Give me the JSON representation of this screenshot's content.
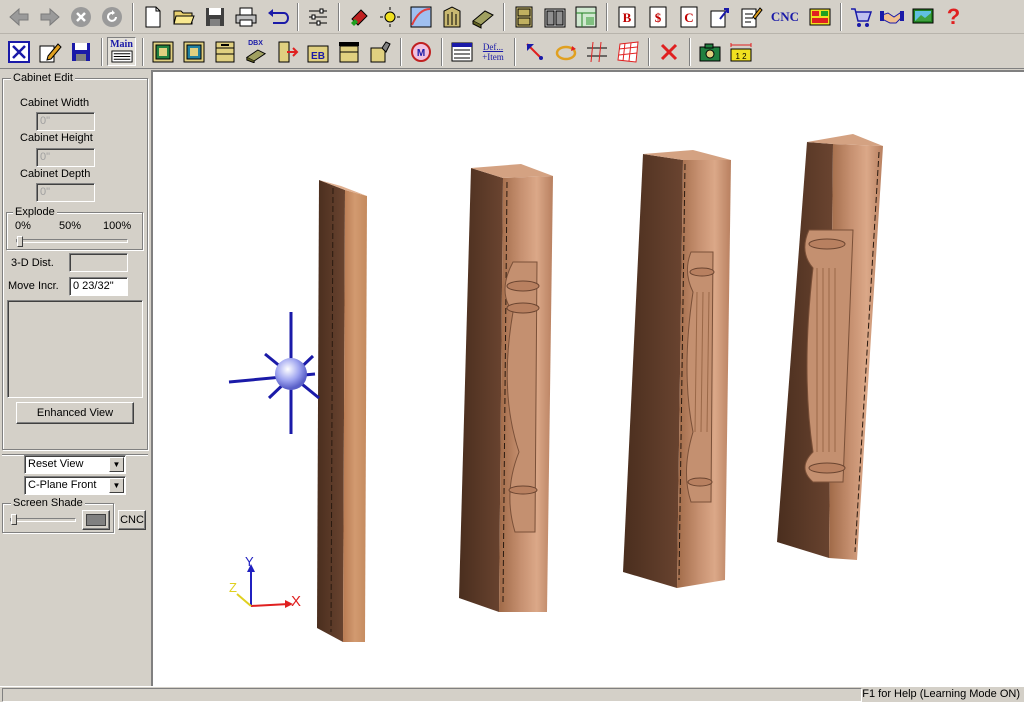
{
  "toolbar1": {
    "items": [
      {
        "name": "back-icon",
        "enabled": false
      },
      {
        "name": "forward-icon",
        "enabled": false
      },
      {
        "name": "stop-icon",
        "enabled": false
      },
      {
        "name": "refresh-icon",
        "enabled": false
      },
      {
        "name": "new-file-icon"
      },
      {
        "name": "open-folder-icon"
      },
      {
        "name": "save-icon"
      },
      {
        "name": "print-icon"
      },
      {
        "name": "undo-icon"
      },
      {
        "name": "settings-sliders-icon"
      },
      {
        "name": "paint-icon"
      },
      {
        "name": "light-icon"
      },
      {
        "name": "curve-icon"
      },
      {
        "name": "door-icon"
      },
      {
        "name": "board-icon"
      },
      {
        "name": "cabinet-icon"
      },
      {
        "name": "cabinet-group-icon"
      },
      {
        "name": "room-layout-icon"
      },
      {
        "name": "bid-report-icon",
        "text": "B"
      },
      {
        "name": "price-report-icon",
        "text": "$"
      },
      {
        "name": "cutlist-report-icon",
        "text": "C"
      },
      {
        "name": "export-icon"
      },
      {
        "name": "edit-report-icon"
      },
      {
        "name": "cnc-button",
        "text": "CNC"
      },
      {
        "name": "layout-icon"
      },
      {
        "name": "shopping-cart-icon"
      },
      {
        "name": "handshake-icon"
      },
      {
        "name": "presentation-icon"
      },
      {
        "name": "help-icon",
        "text": "?"
      }
    ]
  },
  "toolbar2": {
    "items": [
      {
        "name": "cabinet-edit-icon"
      },
      {
        "name": "edit-pencil-icon"
      },
      {
        "name": "save-small-icon"
      },
      {
        "name": "main-menu-button",
        "text": "Main"
      },
      {
        "name": "base-cabinet-icon"
      },
      {
        "name": "wall-cabinet-icon"
      },
      {
        "name": "tall-cabinet-icon"
      },
      {
        "name": "dbx-icon",
        "text": "DBX"
      },
      {
        "name": "resize-icon"
      },
      {
        "name": "edge-band-icon",
        "text": "EB"
      },
      {
        "name": "hardware-icon"
      },
      {
        "name": "finish-icon"
      },
      {
        "name": "materials-icon"
      },
      {
        "name": "parts-list-icon"
      },
      {
        "name": "def-item-button",
        "text": "Def...",
        "text2": "+Item"
      },
      {
        "name": "pointer-icon"
      },
      {
        "name": "rotate-icon"
      },
      {
        "name": "grid-lines-icon"
      },
      {
        "name": "grid-icon"
      },
      {
        "name": "delete-icon"
      },
      {
        "name": "camera-icon"
      },
      {
        "name": "dimension-icon"
      }
    ]
  },
  "cabinet_edit": {
    "group_title": "Cabinet Edit",
    "width_label": "Cabinet Width",
    "width_value": "0\"",
    "height_label": "Cabinet Height",
    "height_value": "0\"",
    "depth_label": "Cabinet Depth",
    "depth_value": "0\"",
    "explode": {
      "title": "Explode",
      "label_0": "0%",
      "label_50": "50%",
      "label_100": "100%",
      "value": 0
    },
    "dist_label": "3-D Dist.",
    "dist_value": "",
    "move_label": "Move Incr.",
    "move_value": "0 23/32\"",
    "enhanced_button": "Enhanced View"
  },
  "view_select": "Reset View",
  "plane_select": "C-Plane Front",
  "screen_shade": {
    "title": "Screen Shade",
    "value": 0
  },
  "cnc_button": "CNC",
  "axis": {
    "y": "Y",
    "z": "Z",
    "x": "X"
  },
  "status": "F1 for Help (Learning Mode ON)",
  "colors": {
    "wood_light": "#c48a5e",
    "wood_dark": "#5a3a26",
    "background": "#d4d0c8",
    "axis_blue": "#2020c0",
    "axis_red": "#e02020",
    "axis_yellow": "#e0d020"
  }
}
